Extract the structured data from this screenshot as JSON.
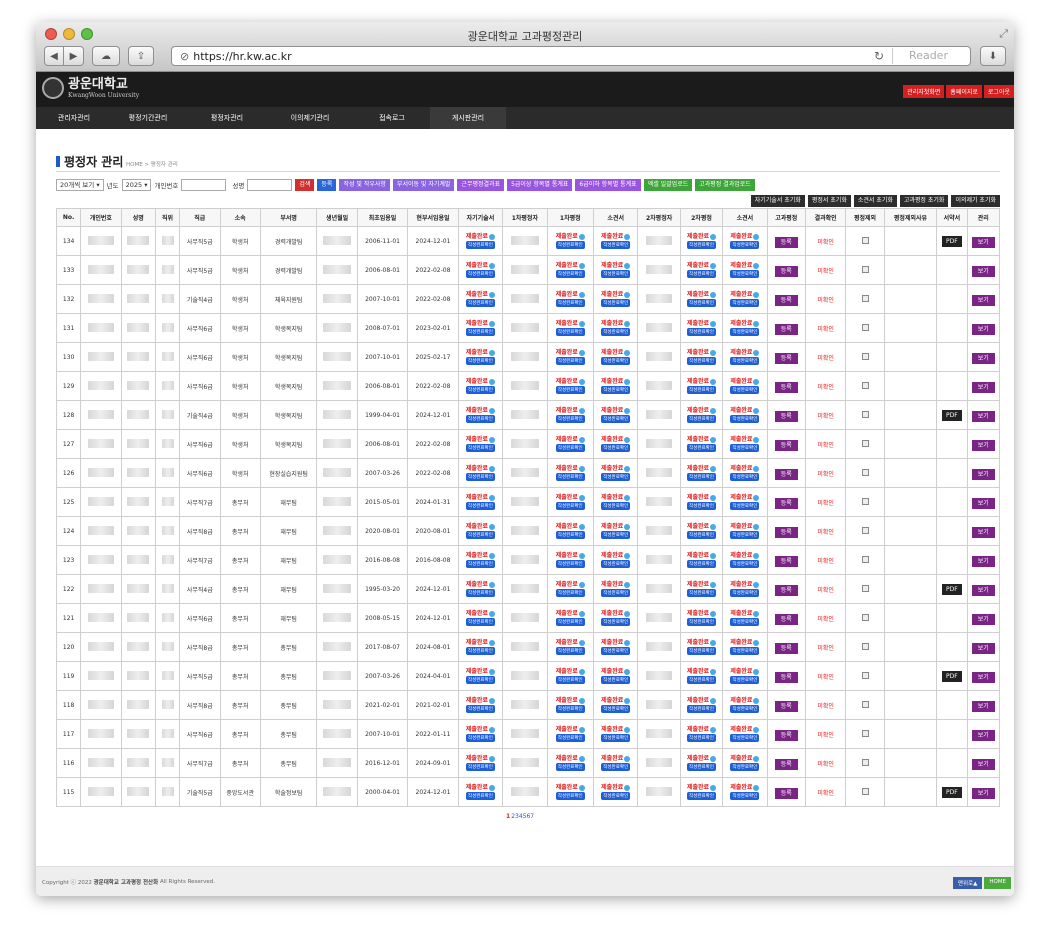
{
  "window": {
    "title": "광운대학교 고과평정관리",
    "url": "https://hr.kw.ac.kr",
    "reader": "Reader"
  },
  "site": {
    "logo_ko": "광운대학교",
    "logo_en": "KwangWoon University",
    "top_links": [
      "관리자첫화면",
      "홈페이지로",
      "로그아웃"
    ],
    "nav": [
      "관리자관리",
      "평정기간관리",
      "평정자관리",
      "이의제기관리",
      "접속로그",
      "게시판관리"
    ]
  },
  "page": {
    "title": "평정자 관리",
    "breadcrumb": "HOME > 평정자 관리"
  },
  "filters": {
    "per_page": "20개씩 보기",
    "year": "2025",
    "year_label": "년도",
    "id_label": "개인번호",
    "name_label": "성명",
    "search_btn": "검색",
    "register_btn": "등록",
    "buttons": [
      {
        "label": "작성 및 작우사항",
        "color": "#8a63e0"
      },
      {
        "label": "부서이동 및 자기계발",
        "color": "#8a63e0"
      },
      {
        "label": "근무평정결과표",
        "color": "#9a55e0"
      },
      {
        "label": "5급이상 항목별 통계표",
        "color": "#9a55e0"
      },
      {
        "label": "6급이하 항목별 통계표",
        "color": "#9a55e0"
      },
      {
        "label": "엑셀 일괄업로드",
        "color": "#3ea53a"
      },
      {
        "label": "고과평정 결과업로드",
        "color": "#3ea53a"
      }
    ],
    "reset_buttons": [
      "자기기술서 초기화",
      "평정서 초기화",
      "소견서 초기화",
      "고과평정 초기화",
      "이의제기 초기화"
    ]
  },
  "table": {
    "headers": [
      "No.",
      "개인번호",
      "성명",
      "직위",
      "직급",
      "소속",
      "부서명",
      "생년월일",
      "최초임용일",
      "현부서임용일",
      "자기기술서",
      "1차평정자",
      "1차평정",
      "소견서",
      "2차평정자",
      "2차평정",
      "소견서",
      "고과평정",
      "결과확인",
      "평정제외",
      "평정제외사유",
      "서약서",
      "관리"
    ],
    "submit_label": "제출완료",
    "check_label": "작성완료확인",
    "register_label": "등록",
    "unconfirmed_label": "미확인",
    "pdf_label": "PDF",
    "view_label": "보기",
    "rows": [
      {
        "no": "134",
        "grade": "사무직5급",
        "org": "학생처",
        "dept": "경력개발팀",
        "first": "2006-11-01",
        "cur": "2024-12-01",
        "pdf": true
      },
      {
        "no": "133",
        "grade": "사무직5급",
        "org": "학생처",
        "dept": "경력개발팀",
        "first": "2006-08-01",
        "cur": "2022-02-08",
        "pdf": false
      },
      {
        "no": "132",
        "grade": "기술직4급",
        "org": "학생처",
        "dept": "체육지원팀",
        "first": "2007-10-01",
        "cur": "2022-02-08",
        "pdf": false
      },
      {
        "no": "131",
        "grade": "사무직6급",
        "org": "학생처",
        "dept": "학생복지팀",
        "first": "2008-07-01",
        "cur": "2023-02-01",
        "pdf": false
      },
      {
        "no": "130",
        "grade": "사무직6급",
        "org": "학생처",
        "dept": "학생복지팀",
        "first": "2007-10-01",
        "cur": "2025-02-17",
        "pdf": false
      },
      {
        "no": "129",
        "grade": "사무직6급",
        "org": "학생처",
        "dept": "학생복지팀",
        "first": "2006-08-01",
        "cur": "2022-02-08",
        "pdf": false
      },
      {
        "no": "128",
        "grade": "기술직4급",
        "org": "학생처",
        "dept": "학생복지팀",
        "first": "1999-04-01",
        "cur": "2024-12-01",
        "pdf": true
      },
      {
        "no": "127",
        "grade": "사무직6급",
        "org": "학생처",
        "dept": "학생복지팀",
        "first": "2006-08-01",
        "cur": "2022-02-08",
        "pdf": false
      },
      {
        "no": "126",
        "grade": "사무직6급",
        "org": "학생처",
        "dept": "현장실습지원팀",
        "first": "2007-03-26",
        "cur": "2022-02-08",
        "pdf": false
      },
      {
        "no": "125",
        "grade": "사무직7급",
        "org": "총무처",
        "dept": "재무팀",
        "first": "2015-05-01",
        "cur": "2024-01-31",
        "pdf": false
      },
      {
        "no": "124",
        "grade": "사무직8급",
        "org": "총무처",
        "dept": "재무팀",
        "first": "2020-08-01",
        "cur": "2020-08-01",
        "pdf": false
      },
      {
        "no": "123",
        "grade": "사무직7급",
        "org": "총무처",
        "dept": "재무팀",
        "first": "2016-08-08",
        "cur": "2016-08-08",
        "pdf": false
      },
      {
        "no": "122",
        "grade": "사무직4급",
        "org": "총무처",
        "dept": "재무팀",
        "first": "1995-03-20",
        "cur": "2024-12-01",
        "pdf": true
      },
      {
        "no": "121",
        "grade": "사무직6급",
        "org": "총무처",
        "dept": "재무팀",
        "first": "2008-05-15",
        "cur": "2024-12-01",
        "pdf": false
      },
      {
        "no": "120",
        "grade": "사무직8급",
        "org": "총무처",
        "dept": "총무팀",
        "first": "2017-08-07",
        "cur": "2024-08-01",
        "pdf": false
      },
      {
        "no": "119",
        "grade": "사무직5급",
        "org": "총무처",
        "dept": "총무팀",
        "first": "2007-03-26",
        "cur": "2024-04-01",
        "pdf": true
      },
      {
        "no": "118",
        "grade": "사무직8급",
        "org": "총무처",
        "dept": "총무팀",
        "first": "2021-02-01",
        "cur": "2021-02-01",
        "pdf": false
      },
      {
        "no": "117",
        "grade": "사무직6급",
        "org": "총무처",
        "dept": "총무팀",
        "first": "2007-10-01",
        "cur": "2022-01-11",
        "pdf": false
      },
      {
        "no": "116",
        "grade": "사무직7급",
        "org": "총무처",
        "dept": "총무팀",
        "first": "2016-12-01",
        "cur": "2024-09-01",
        "pdf": false
      },
      {
        "no": "115",
        "grade": "기술직5급",
        "org": "중앙도서관",
        "dept": "학술정보팀",
        "first": "2000-04-01",
        "cur": "2024-12-01",
        "pdf": true
      }
    ]
  },
  "pagination": {
    "current": "1",
    "others": "234567"
  },
  "footer": {
    "copyright": "Copyright ⓒ 2022",
    "org": "광운대학교 고과평정 전산화",
    "rights": "All Rights Reserved.",
    "top_btn": "맨위로▲",
    "home_btn": "HOME"
  }
}
